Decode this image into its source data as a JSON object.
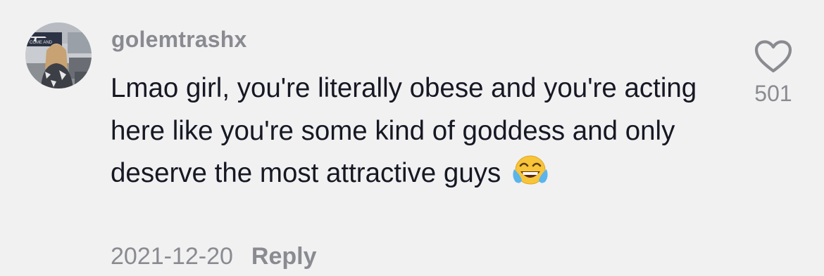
{
  "comment": {
    "username": "golemtrashx",
    "text": "Lmao girl, you're literally obese and you're acting here like you're some kind of goddess and only deserve the most attractive guys",
    "emoji": "face-with-tears-of-joy",
    "date": "2021-12-20",
    "reply_label": "Reply",
    "like_count": "501",
    "avatar_flag_text": "COME AND"
  },
  "colors": {
    "background": "#f1f1f2",
    "text": "#161823",
    "secondary": "#8a8b91"
  }
}
